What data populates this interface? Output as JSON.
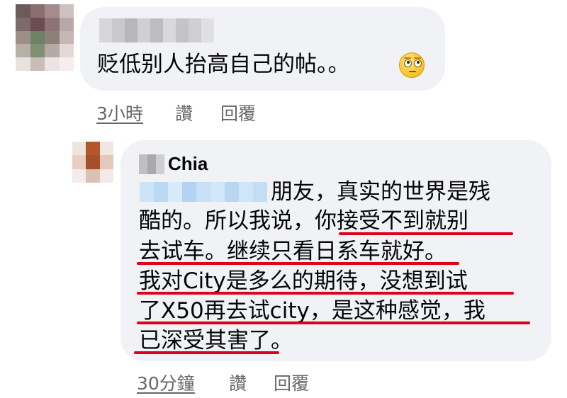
{
  "comment1": {
    "text": "贬低别人抬高自己的帖。。",
    "emoji": "face-with-rolling-eyes",
    "actions": {
      "time": "3小時",
      "like": "讚",
      "reply": "回覆"
    }
  },
  "comment2": {
    "author": "Chia",
    "lines": [
      "朋友，真实的世界是残",
      "酷的。所以我说，你接受不到就别",
      "去试车。继续只看日系车就好。",
      "我对City是多么的期待，没想到试",
      "了X50再去试city，是这种感觉，我",
      "已深受其害了。"
    ],
    "actions": {
      "time": "30分鐘",
      "like": "讚",
      "reply": "回覆"
    }
  },
  "colors": {
    "bubble": "#f0f2f5",
    "action_text": "#65676b",
    "annotation_underline": "#e0001b"
  }
}
